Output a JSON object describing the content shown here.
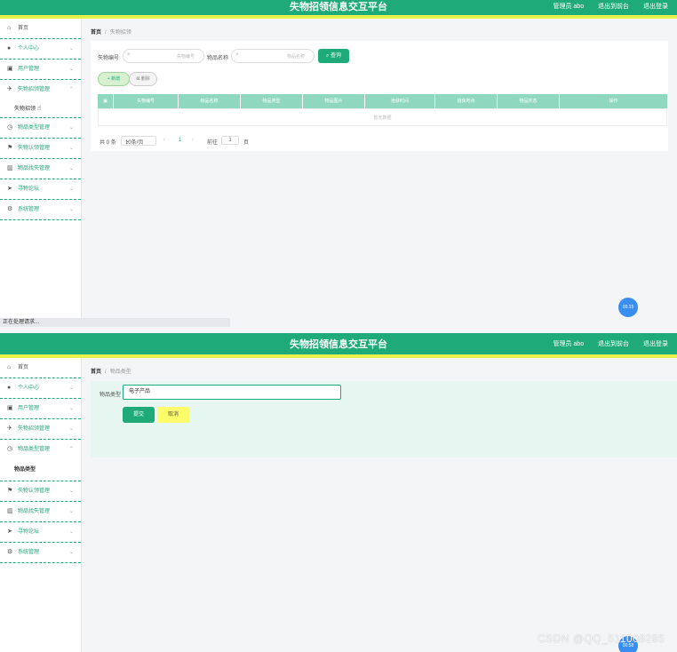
{
  "app": {
    "title": "失物招领信息交互平台"
  },
  "header": {
    "admin": "管理员 abo",
    "back_to_home": "退出到前台",
    "logout": "退出登录"
  },
  "sidebar": {
    "home": "首页",
    "items": [
      "个人中心",
      "用户管理",
      "失物招领管理",
      "物品类型管理",
      "失物认领管理",
      "物品找失管理",
      "寻物论坛",
      "系统管理"
    ],
    "top_submenu": "失物招领",
    "bottom_submenu": "物品类型"
  },
  "top": {
    "breadcrumb": {
      "home": "首页",
      "separator": "/",
      "current": "失物招领"
    },
    "search": {
      "label_number": "失物编号",
      "placeholder_number": "失物编号",
      "label_name": "物品名称",
      "placeholder_name": "物品名称",
      "query_button": "查询"
    },
    "actions": {
      "add": "+ 新增",
      "delete": "删除"
    },
    "table": {
      "columns": [
        "失物编号",
        "物品名称",
        "物品类型",
        "物品图片",
        "拾获时间",
        "拾获地点",
        "物品状态",
        "操作"
      ],
      "empty_text": "暂无数据"
    },
    "pagination": {
      "total": "共 0 条",
      "page_size": "10条/页",
      "current_page": "1",
      "goto_label": "前往",
      "goto_value": "1",
      "page_unit": "页"
    },
    "loading_text": "正在处理请求...",
    "timer": "00:15"
  },
  "bottom": {
    "breadcrumb": {
      "home": "首页",
      "separator": "/",
      "current": "物品类型"
    },
    "form": {
      "label": "物品类型",
      "value": "电子产品",
      "submit": "提交",
      "cancel": "取消"
    },
    "timer": "00:58"
  },
  "watermark": "CSDN @QQ_511008285",
  "colors": {
    "primary": "#1faa7a",
    "accent_yellow": "#e8f24a",
    "header_row": "#8fd8bf",
    "timer_blue": "#3a8ef0"
  }
}
